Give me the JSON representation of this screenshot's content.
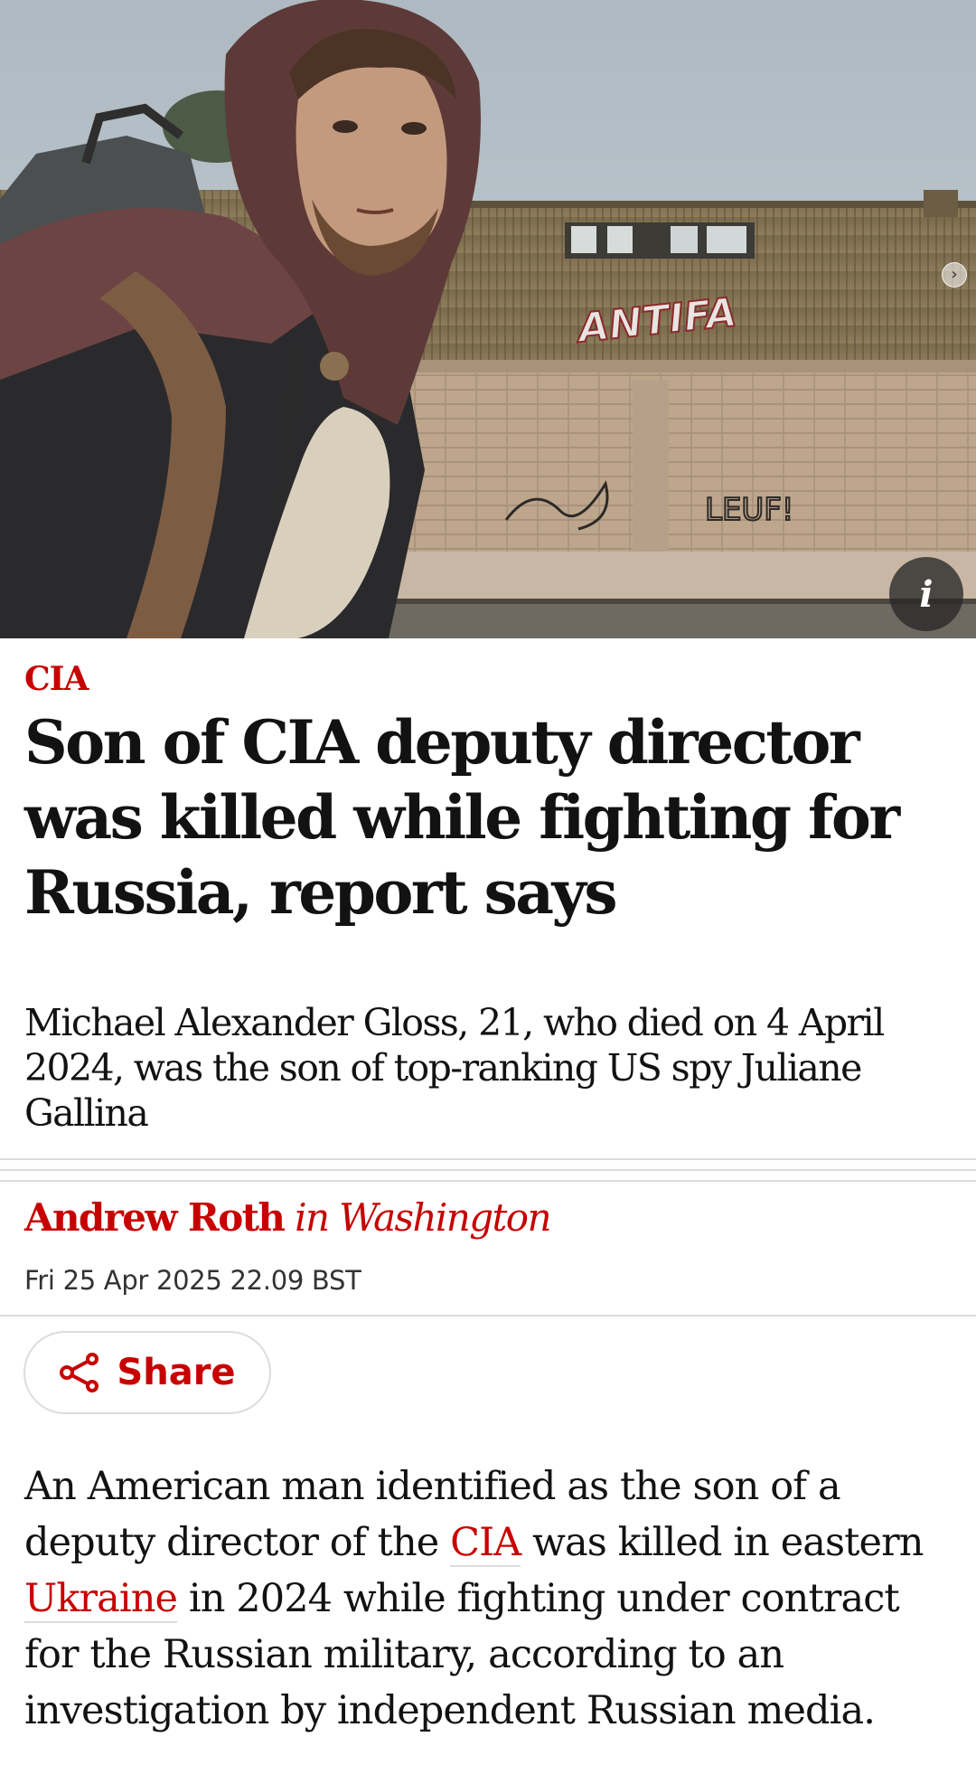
{
  "article": {
    "section": "CIA",
    "headline": "Son of CIA deputy director was killed while fighting for Russia, report says",
    "standfirst": "Michael Alexander Gloss, 21, who died on 4 April 2024, was the son of top-ranking US spy Juliane Gallina",
    "author": "Andrew Roth",
    "location": "in Washington",
    "date": "Fri 25 Apr 2025 22.09 BST",
    "share_label": "Share",
    "body": {
      "part1": "An American man identified as the son of a deputy director of the ",
      "link1": "CIA",
      "part2": " was killed in eastern ",
      "link2": "Ukraine",
      "part3": " in 2024 while fighting under contract for the Russian military, according to an investigation by independent Russian media."
    }
  },
  "image": {
    "graffiti_top": "ANTIFA",
    "graffiti_bottom": "LEUF!",
    "info_icon": "i"
  },
  "colors": {
    "accent": "#c70000",
    "text": "#121212",
    "rule": "#dcdcdc"
  },
  "icons": [
    "info-icon",
    "share-icon",
    "carousel-next-icon"
  ]
}
